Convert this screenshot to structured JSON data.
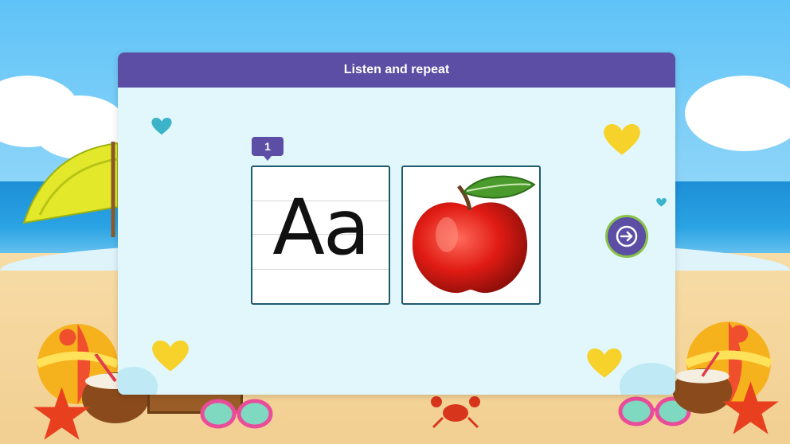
{
  "dialog": {
    "title": "Listen and repeat",
    "item_number": "1",
    "letter_card": {
      "text": "Aa"
    },
    "image_card": {
      "subject": "apple"
    },
    "next_button": {
      "icon": "arrow-right-icon"
    }
  },
  "colors": {
    "header": "#5b4ea4",
    "panel": "#e1f7fb",
    "card_border": "#1f5b6e",
    "next_ring": "#8bc34a",
    "heart_yellow": "#f7d22a",
    "heart_teal": "#3bb3c9"
  },
  "decorations": {
    "background": "beach-scene",
    "items": [
      "umbrella",
      "beach-ball",
      "coconut-drink",
      "starfish",
      "sunglasses",
      "crab",
      "hearts"
    ]
  }
}
